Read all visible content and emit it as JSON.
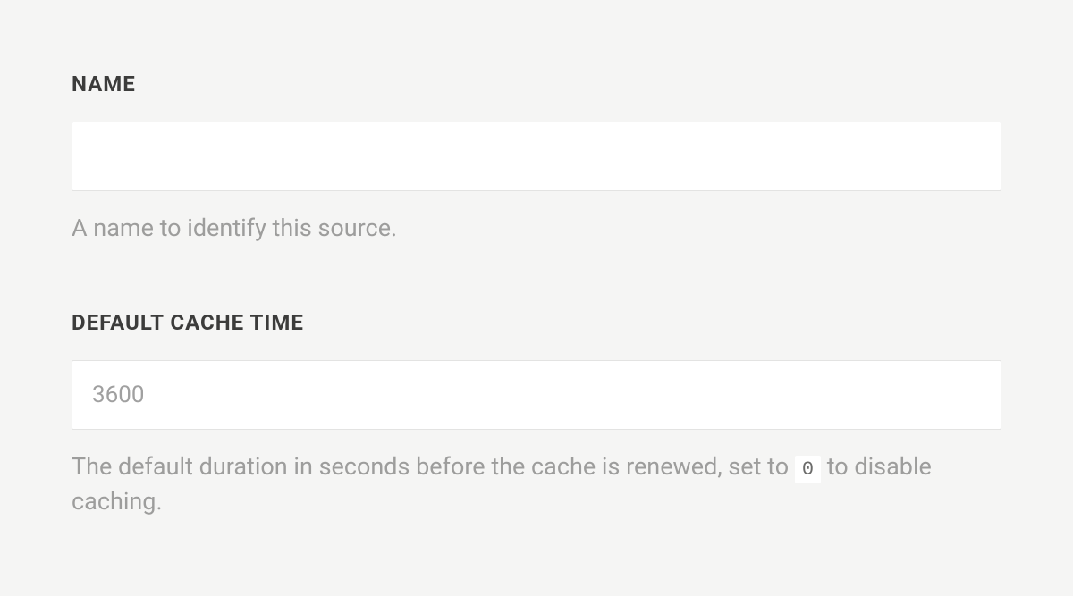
{
  "form": {
    "name": {
      "label": "NAME",
      "value": "",
      "help": "A name to identify this source."
    },
    "cache": {
      "label": "DEFAULT CACHE TIME",
      "placeholder": "3600",
      "value": "",
      "help_prefix": "The default duration in seconds before the cache is renewed, set to ",
      "help_code": "0",
      "help_suffix": " to disable caching."
    }
  }
}
